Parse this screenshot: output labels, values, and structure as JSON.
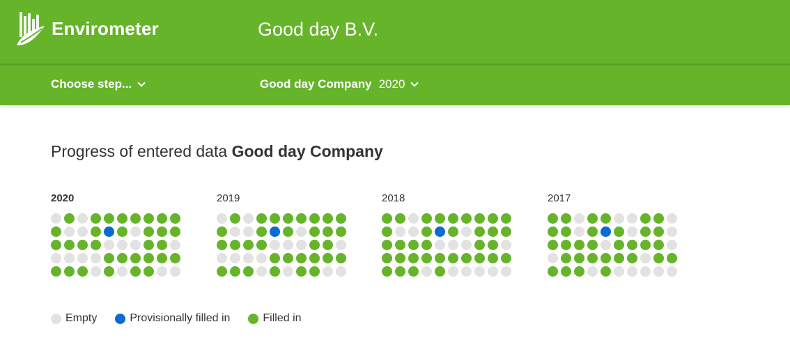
{
  "header": {
    "brand": "Envirometer",
    "company_title": "Good day B.V.",
    "logo_icon": "envirometer-logo-icon",
    "color": "#66b42a"
  },
  "subbar": {
    "step_dropdown": "Choose step...",
    "company_dropdown": "Good day Company",
    "year_dropdown": "2020"
  },
  "main": {
    "heading_prefix": "Progress of entered data",
    "heading_company": "Good day Company"
  },
  "years": [
    {
      "label": "2020",
      "rows": [
        "efeffffffff",
        "feefpfeffff",
        "ffffeeeffe",
        "eeeeffffff",
        "fffefeffeef"
      ]
    },
    {
      "label": "2019",
      "rows": [
        "efeffffffff",
        "feefpfeffff",
        "ffffeeeffe",
        "eeeeffffff",
        "fffefeffeef"
      ]
    },
    {
      "label": "2018",
      "rows": [
        "ffeffffffff",
        "feefpfeffff",
        "ffffeeeffe",
        "ffffffffff",
        "fffefeeeeee"
      ]
    },
    {
      "label": "2017",
      "rows": [
        "ffeffeeffe",
        "ffefpfeffe",
        "ffffeffffe",
        "effffffeff",
        "fffefeeeee"
      ]
    }
  ],
  "legend": [
    {
      "key": "e",
      "label": "Empty",
      "color": "#e2e2e2"
    },
    {
      "key": "p",
      "label": "Provisionally filled in",
      "color": "#0a6cd1"
    },
    {
      "key": "f",
      "label": "Filled in",
      "color": "#66b42a"
    }
  ]
}
